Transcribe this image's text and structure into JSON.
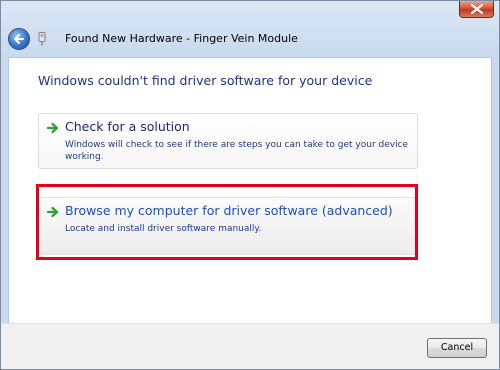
{
  "window": {
    "nav_title": "Found New Hardware - Finger Vein Module"
  },
  "main": {
    "heading": "Windows couldn't find driver software for your device"
  },
  "options": [
    {
      "title": "Check for a solution",
      "description": "Windows will check to see if there are steps you can take to get your device working."
    },
    {
      "title": "Browse my computer for driver software (advanced)",
      "description": "Locate and install driver software manually."
    }
  ],
  "footer": {
    "cancel_label": "Cancel"
  },
  "icons": {
    "close": "close-icon",
    "back": "back-arrow-icon",
    "device": "hardware-device-icon",
    "option_arrow": "green-arrow-icon"
  },
  "colors": {
    "heading": "#1e3287",
    "link": "#1a4fbf",
    "highlight": "#e3001b",
    "arrow": "#2da12d"
  }
}
